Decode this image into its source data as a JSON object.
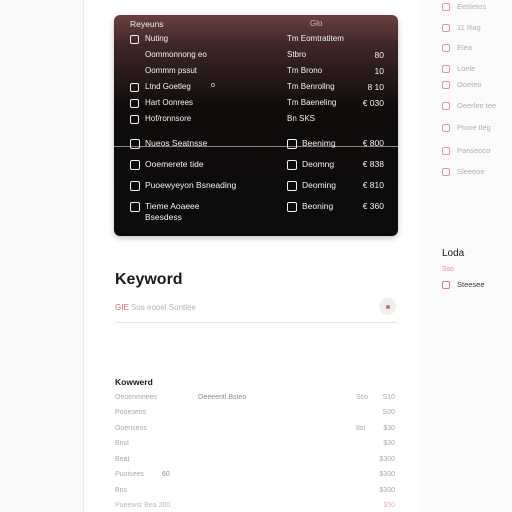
{
  "panel": {
    "header_left": "Reyeuns",
    "header_right": "Glo",
    "rows": [
      {
        "check": true,
        "name": "Nuting",
        "mid": "Tm Eomtratitem",
        "mid_check": false,
        "amount": ""
      },
      {
        "check": false,
        "name": "Oommonnong eo",
        "mid": "Stbro",
        "mid_check": false,
        "amount": "80"
      },
      {
        "check": false,
        "name": "Oommm pssut",
        "mid": "Tm Brono",
        "mid_check": false,
        "amount": "10"
      },
      {
        "check": true,
        "name": "Ltnd Goetleg",
        "mid": "Tm Benrollng",
        "mid_check": false,
        "amount": "8 10",
        "dot": "o"
      },
      {
        "check": true,
        "name": "Hart Oonrees",
        "mid": "Tm Baeneling",
        "mid_check": false,
        "amount": "€ 030"
      },
      {
        "check": true,
        "name": "Hof/ronnsore",
        "mid": "Bn SKS",
        "mid_check": false,
        "amount": ""
      }
    ],
    "rows_lower": [
      {
        "check": true,
        "name": "Nueos Seatnsse",
        "mid": "Beenimg",
        "amount": "€ 800"
      },
      {
        "check": true,
        "name": "Ooemerete tide",
        "mid": "Deomng",
        "amount": "€ 838"
      },
      {
        "check": true,
        "name": "Puoewyeyon Bsneading",
        "mid": "Deoming",
        "amount": "€ 810"
      },
      {
        "check": true,
        "name": "Tieme  Aoaeee",
        "name2": "Bsesdess",
        "mid": "Beoning",
        "amount": "€ 360"
      }
    ]
  },
  "keyword": {
    "title": "Keyword",
    "subtitle_highlight": "GIE",
    "subtitle_rest": " Sos eooel Sontlee"
  },
  "table": {
    "header": "Kowwerd",
    "rows": [
      {
        "c1": "Oeoenmnees",
        "c2": "Oeeeentl.Bsteo",
        "c3": "Sco",
        "c4": "S10"
      },
      {
        "c1": "Pooeseos",
        "c2": "",
        "c3": "",
        "c4": "S00"
      },
      {
        "c1": "Ooenseos",
        "c2": "",
        "c3": "8st",
        "c4": "$30"
      },
      {
        "c1": "Bnst",
        "c2": "",
        "c3": "",
        "c4": "$30"
      },
      {
        "c1": "Beat",
        "c2": "",
        "c3": "",
        "c4": "$300"
      },
      {
        "c1": "Puoisees",
        "c2": "60",
        "c3": "",
        "c4": "$300"
      },
      {
        "c1": "Bns",
        "c2": "",
        "c3": "",
        "c4": "$300"
      },
      {
        "c1": "Pueewsr  Bea 200",
        "c2": "",
        "c3": "",
        "c4": "$50"
      }
    ]
  },
  "sidebar": {
    "items": [
      "Eettietos",
      "11 Rag",
      "Elea",
      "Loele",
      "Ooeteo",
      "Oeerlee tee",
      "Ptooe tleg",
      "Panseoco",
      "Sleeeoe"
    ],
    "section_label": "Loda",
    "section_sub": "Sso",
    "section_item": "Steesee"
  },
  "colors": {
    "accent": "#d88080",
    "panel_top": "#6a4040",
    "panel_bottom": "#0b0b0b"
  }
}
